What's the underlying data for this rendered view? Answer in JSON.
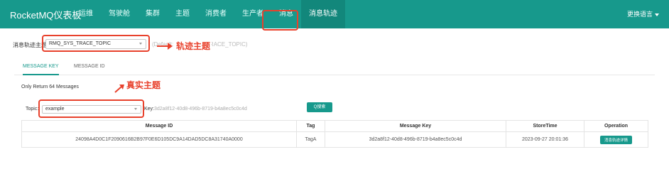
{
  "app": {
    "title": "RocketMQ仪表板"
  },
  "nav": {
    "items": [
      {
        "label": "运维"
      },
      {
        "label": "驾驶舱"
      },
      {
        "label": "集群"
      },
      {
        "label": "主题"
      },
      {
        "label": "消费者"
      },
      {
        "label": "生产者"
      },
      {
        "label": "消息"
      },
      {
        "label": "消息轨迹"
      }
    ],
    "active_index": 7,
    "language_label": "更换语言"
  },
  "trace_topic": {
    "label": "消息轨迹主题",
    "selected": "RMQ_SYS_TRACE_TOPIC",
    "hint": "(Default: RMQ_SYS_TRACE_TOPIC)"
  },
  "annotations": {
    "trace_topic_note": "轨迹主题",
    "real_topic_note": "真实主题",
    "color": "#e8412c"
  },
  "tabs": [
    {
      "label": "MESSAGE KEY"
    },
    {
      "label": "MESSAGE ID"
    }
  ],
  "info_text": "Only Return 64 Messages",
  "search": {
    "topic_label": "Topic:",
    "topic_selected": "example",
    "key_label": "Key:",
    "key_value": "3d2a8f12-40d8-496b-8719-b4a8ec5c0c4d",
    "button_label": "Q搜索"
  },
  "table": {
    "columns": [
      "Message ID",
      "Tag",
      "Message Key",
      "StoreTime",
      "Operation"
    ],
    "rows": [
      {
        "message_id": "24098A4D0C1F2090616B2B97F0E6D105DC9A14DAD5DC8A31740A0000",
        "tag": "TagA",
        "message_key": "3d2a8f12-40d8-496b-8719-b4a8ec5c0c4d",
        "store_time": "2023-09-27 20:01:36",
        "operation": "消息轨迹详情"
      }
    ]
  },
  "colors": {
    "primary": "#17998c",
    "annotation": "#e8412c"
  }
}
